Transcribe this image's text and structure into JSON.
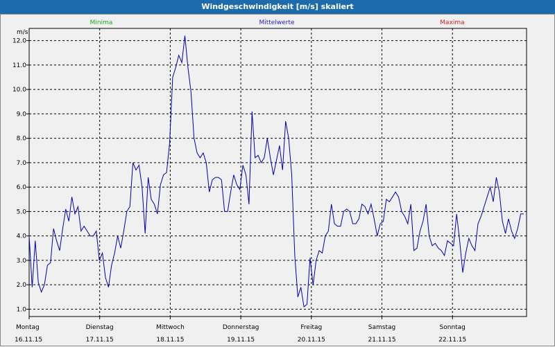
{
  "window": {
    "title": "Windgeschwindigkeit [m/s] skaliert"
  },
  "colors": {
    "title_bar": "#1e6bab",
    "minima": "#22aa22",
    "mittelwerte": "#2222cc",
    "maxima": "#cc2222",
    "series": "#0000aa"
  },
  "chart_data": {
    "type": "line",
    "title": "Windgeschwindigkeit [m/s] skaliert",
    "ylabel": "m/s",
    "ylim": [
      0.7,
      12.5
    ],
    "yticks": [
      "1.0",
      "2.0",
      "3.0",
      "4.0",
      "5.0",
      "6.0",
      "7.0",
      "8.0",
      "9.0",
      "10.0",
      "11.0",
      "12.0"
    ],
    "x_days": [
      {
        "day": "Montag",
        "date": "16.11.15"
      },
      {
        "day": "Dienstag",
        "date": "17.11.15"
      },
      {
        "day": "Mittwoch",
        "date": "18.11.15"
      },
      {
        "day": "Donnerstag",
        "date": "19.11.15"
      },
      {
        "day": "Freitag",
        "date": "20.11.15"
      },
      {
        "day": "Samstag",
        "date": "21.11.15"
      },
      {
        "day": "Sonntag",
        "date": "22.11.15"
      }
    ],
    "grid": true,
    "legend": [
      "Minima",
      "Mittelwerte",
      "Maxima"
    ],
    "series": [
      {
        "values": [
          4.0,
          1.9,
          3.8,
          2.1,
          1.7,
          2.0,
          2.8,
          2.9,
          4.3,
          3.8,
          3.4,
          4.3,
          5.1,
          4.6,
          5.6,
          4.9,
          5.2,
          4.2,
          4.4,
          4.2,
          4.0,
          4.0,
          4.2,
          3.0,
          3.3,
          2.3,
          1.9,
          2.8,
          3.3,
          4.0,
          3.5,
          4.2,
          5.0,
          5.2,
          7.0,
          6.7,
          6.9,
          6.0,
          4.1,
          6.4,
          5.5,
          5.3,
          4.9,
          6.1,
          6.5,
          6.6,
          7.8,
          10.5,
          10.9,
          11.4,
          11.1,
          12.2,
          10.9,
          9.9,
          8.0,
          7.4,
          7.2,
          7.4,
          7.0,
          5.8,
          6.3,
          6.4,
          6.4,
          6.3,
          5.0,
          5.0,
          5.8,
          6.5,
          6.1,
          5.9,
          6.9,
          6.5,
          5.3,
          9.1,
          7.2,
          7.3,
          7.0,
          7.2,
          8.0,
          7.2,
          6.5,
          7.1,
          7.7,
          6.7,
          8.7,
          8.0,
          6.5,
          3.2,
          1.5,
          1.9,
          1.1,
          1.2,
          3.1,
          2.0,
          3.0,
          3.4,
          3.3,
          4.0,
          4.2,
          5.3,
          4.5,
          4.4,
          4.4,
          5.0,
          5.1,
          5.0,
          4.5,
          4.5,
          4.7,
          5.3,
          5.2,
          4.9,
          5.3,
          4.7,
          4.0,
          4.5,
          4.6,
          5.5,
          5.4,
          5.6,
          5.8,
          5.6,
          5.0,
          4.8,
          4.5,
          5.3,
          3.4,
          3.5,
          4.2,
          4.6,
          5.3,
          4.0,
          3.6,
          3.7,
          3.5,
          3.4,
          3.2,
          3.8,
          3.7,
          3.6,
          4.9,
          3.8,
          2.5,
          3.3,
          3.9,
          3.6,
          3.4,
          4.5,
          4.8,
          5.2,
          5.6,
          6.0,
          5.4,
          6.4,
          5.8,
          4.6,
          4.1,
          4.7,
          4.2,
          3.9,
          4.3,
          4.9,
          4.9
        ]
      }
    ]
  }
}
